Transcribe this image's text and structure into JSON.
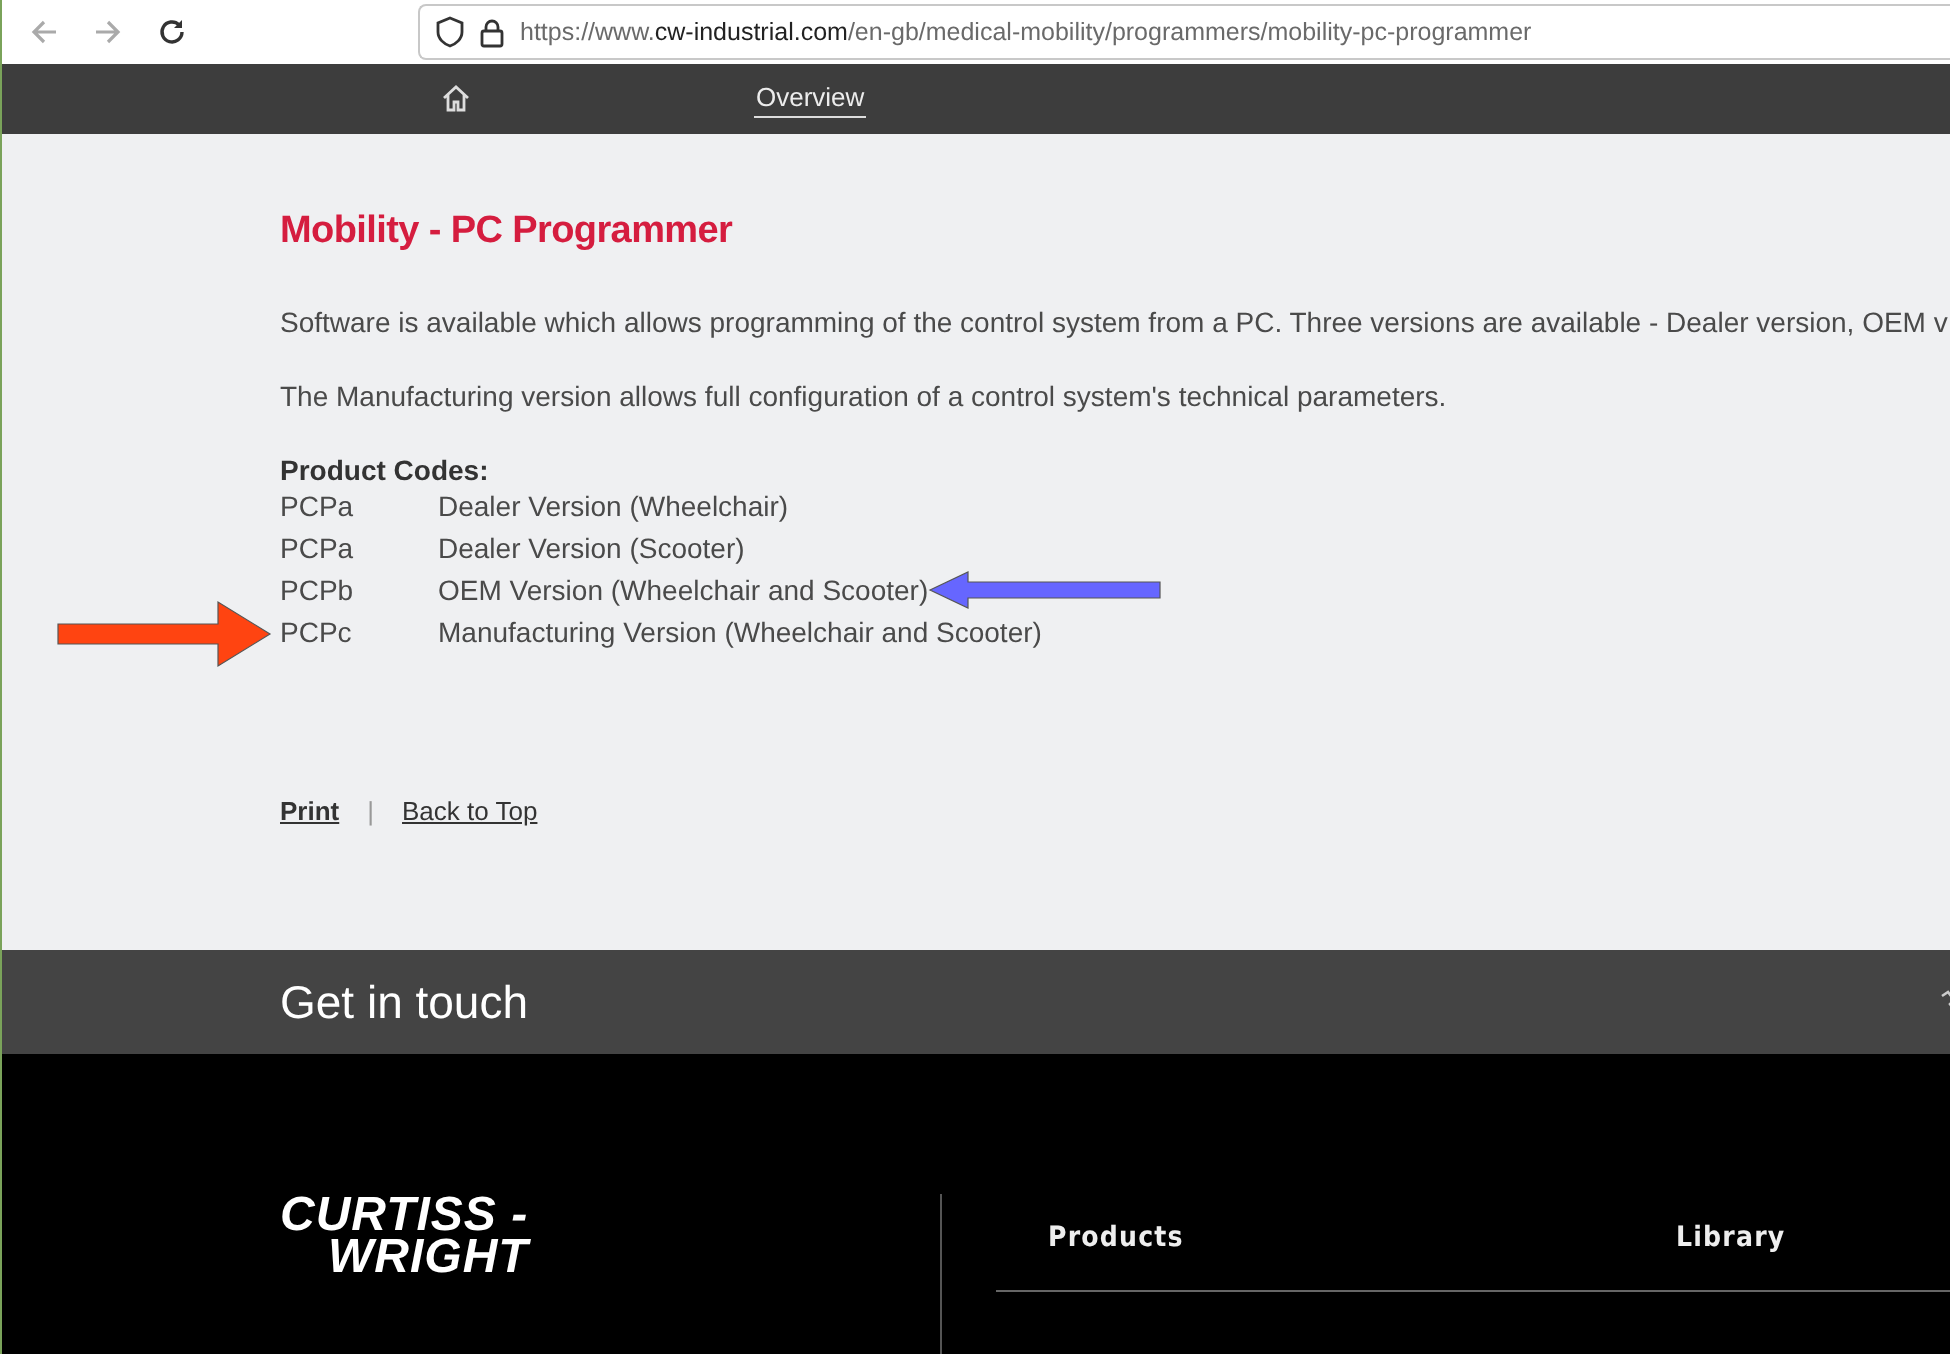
{
  "browser": {
    "url": {
      "prefix": "https://www.",
      "domain": "cw-industrial.com",
      "path": "/en-gb/medical-mobility/programmers/mobility-pc-programmer"
    }
  },
  "nav": {
    "items": [
      {
        "kind": "home",
        "selected": false
      },
      {
        "kind": "text",
        "label": "Overview",
        "selected": true
      }
    ]
  },
  "article": {
    "title": "Mobility - PC Programmer",
    "paragraphs": [
      "Software is available which allows programming of the control system from a PC. Three versions are available - Dealer version, OEM v",
      "The Manufacturing version allows full configuration of a control system's technical parameters."
    ],
    "codes_heading": "Product Codes:",
    "codes": [
      {
        "code": "PCPa",
        "description": "Dealer Version (Wheelchair)",
        "arrow_before": false,
        "arrow_after": false
      },
      {
        "code": "PCPa",
        "description": "Dealer Version (Scooter)",
        "arrow_before": false,
        "arrow_after": false
      },
      {
        "code": "PCPb",
        "description": "OEM Version (Wheelchair and Scooter)",
        "arrow_before": false,
        "arrow_after": true,
        "color": "#6666ff"
      },
      {
        "code": "PCPc",
        "description": "Manufacturing Version (Wheelchair and Scooter)",
        "arrow_before": true,
        "arrow_after": false,
        "color": "#ff4411"
      }
    ],
    "links": [
      "Print",
      "Back to Top"
    ],
    "separator": "|"
  },
  "contact": {
    "title": "Get in touch"
  },
  "footer": {
    "logo": [
      "CURTISS -",
      "WRIGHT"
    ],
    "columns": [
      "Products",
      "Library"
    ]
  }
}
